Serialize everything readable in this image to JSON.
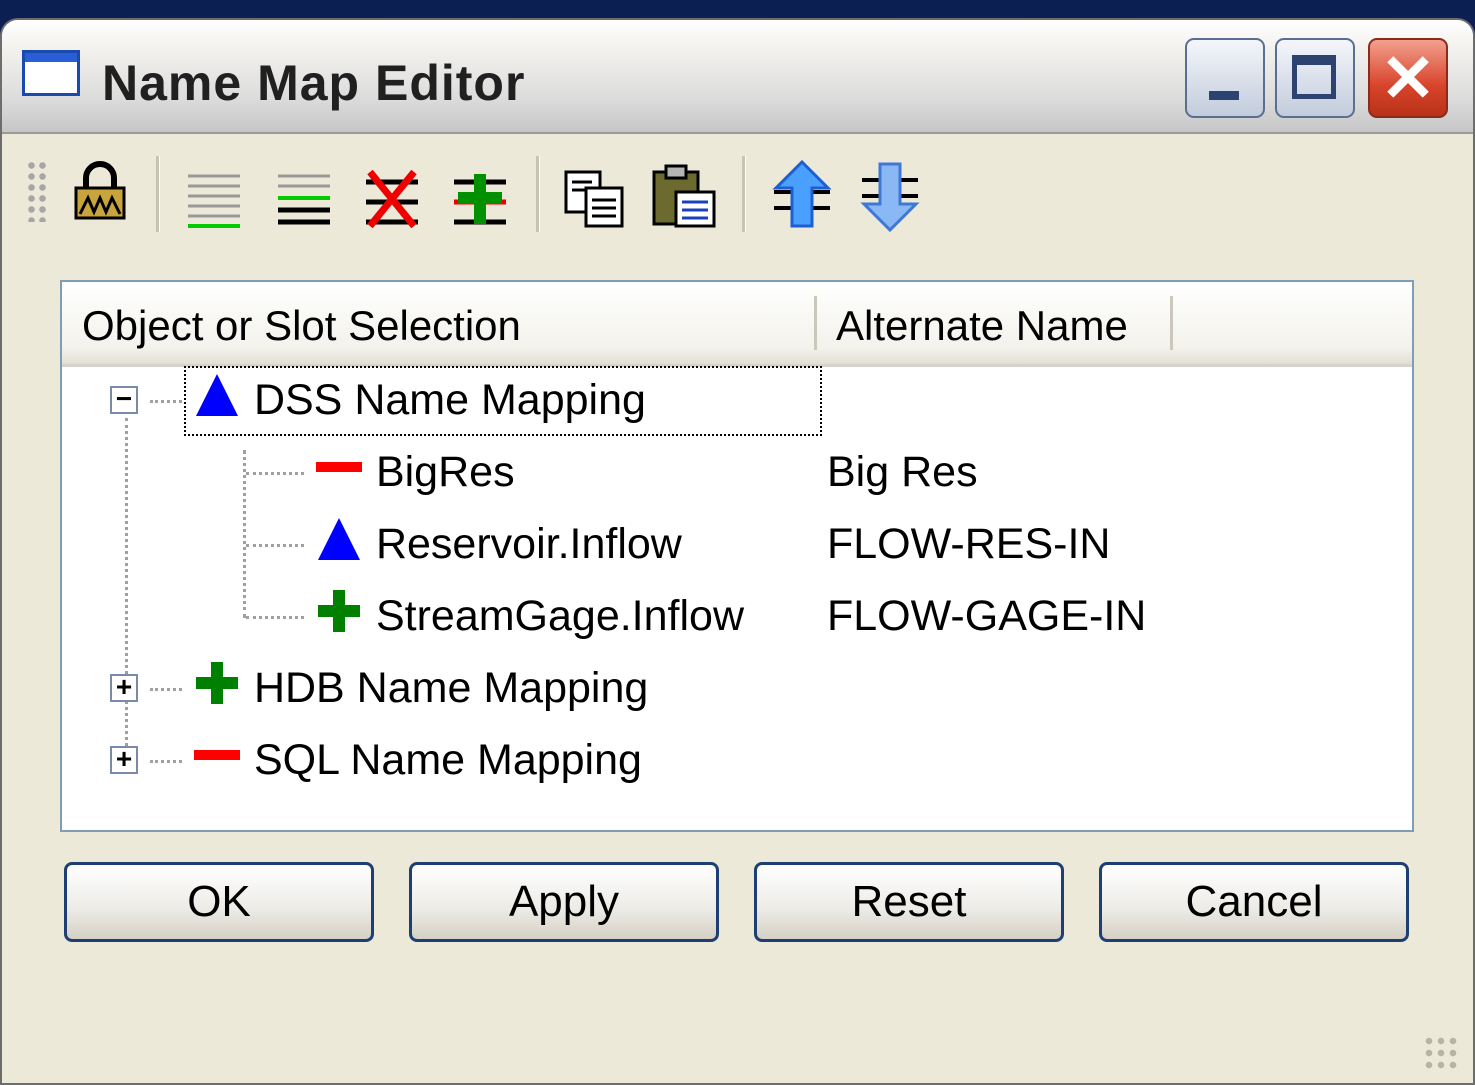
{
  "window": {
    "title": "Name Map Editor",
    "close_glyph": "✕"
  },
  "toolbar": {
    "tools": [
      {
        "name": "lock-icon"
      },
      {
        "name": "align-lines-icon"
      },
      {
        "name": "insert-row-icon"
      },
      {
        "name": "delete-row-icon"
      },
      {
        "name": "add-row-icon"
      },
      {
        "name": "copy-icon"
      },
      {
        "name": "paste-icon"
      },
      {
        "name": "move-up-icon"
      },
      {
        "name": "move-down-icon"
      }
    ]
  },
  "table": {
    "columns": [
      "Object or Slot Selection",
      "Alternate Name"
    ],
    "expander_minus": "−",
    "expander_plus": "+",
    "rows": [
      {
        "label": "DSS Name Mapping",
        "icon": "blue-triangle-icon",
        "alt": "",
        "level": 0,
        "expanded": true
      },
      {
        "label": "BigRes",
        "icon": "red-dash-icon",
        "alt": "Big Res",
        "level": 1
      },
      {
        "label": "Reservoir.Inflow",
        "icon": "blue-triangle-icon",
        "alt": "FLOW-RES-IN",
        "level": 1
      },
      {
        "label": "StreamGage.Inflow",
        "icon": "green-plus-icon",
        "alt": "FLOW-GAGE-IN",
        "level": 1
      },
      {
        "label": "HDB Name Mapping",
        "icon": "green-plus-icon",
        "alt": "",
        "level": 0,
        "expanded": false
      },
      {
        "label": "SQL Name Mapping",
        "icon": "red-dash-icon",
        "alt": "",
        "level": 0,
        "expanded": false
      }
    ]
  },
  "buttons": {
    "ok": "OK",
    "apply": "Apply",
    "reset": "Reset",
    "cancel": "Cancel"
  },
  "colors": {
    "blue_triangle": "#0000ff",
    "green_plus": "#008000",
    "red_dash": "#ff0000"
  }
}
